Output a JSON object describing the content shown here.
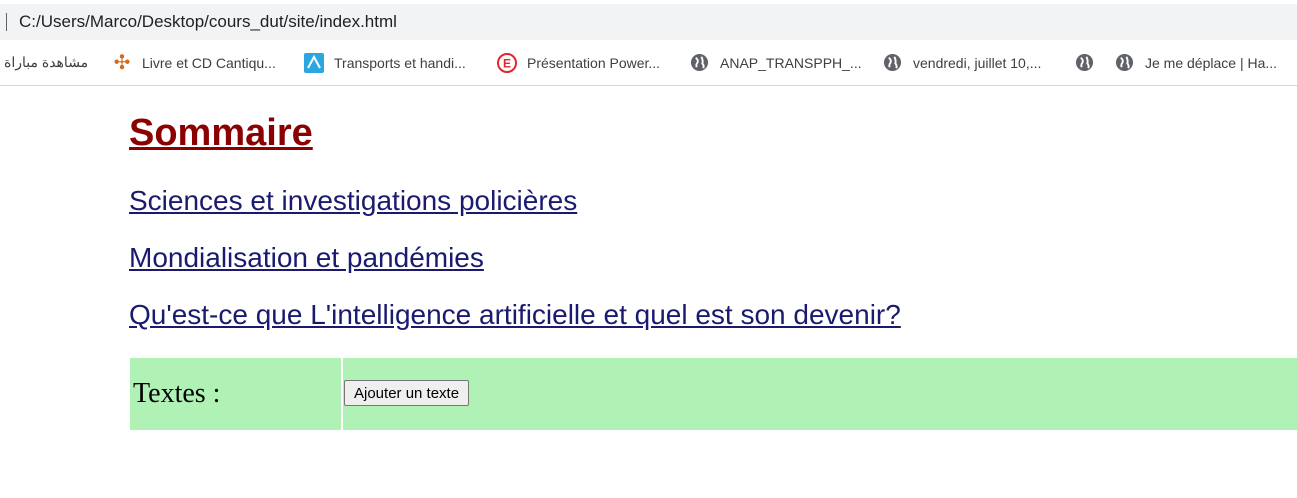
{
  "browser": {
    "url": "C:/Users/Marco/Desktop/cours_dut/site/index.html",
    "bookmarks": [
      {
        "label": "مشاهدة مباراة",
        "icon": "none"
      },
      {
        "label": "Livre et CD Cantiqu...",
        "icon": "cross-icon"
      },
      {
        "label": "Transports et handi...",
        "icon": "arrow-icon"
      },
      {
        "label": "Présentation Power...",
        "icon": "e-logo-icon"
      },
      {
        "label": "ANAP_TRANSPPH_...",
        "icon": "globe-icon"
      },
      {
        "label": "vendredi, juillet 10,...",
        "icon": "globe-icon"
      },
      {
        "label": "",
        "icon": "globe-icon"
      },
      {
        "label": "Je me déplace | Ha...",
        "icon": "globe-icon"
      }
    ]
  },
  "page": {
    "title": "Sommaire",
    "links": [
      "Sciences et investigations policières",
      "Mondialisation et pandémies",
      "Qu'est-ce que L'intelligence artificielle et quel est son devenir?"
    ],
    "texts_label": "Textes :",
    "add_button": "Ajouter un texte"
  },
  "colors": {
    "title": "#8b0000",
    "link": "#1a1a6e",
    "row_background": "#b0f2b6"
  }
}
